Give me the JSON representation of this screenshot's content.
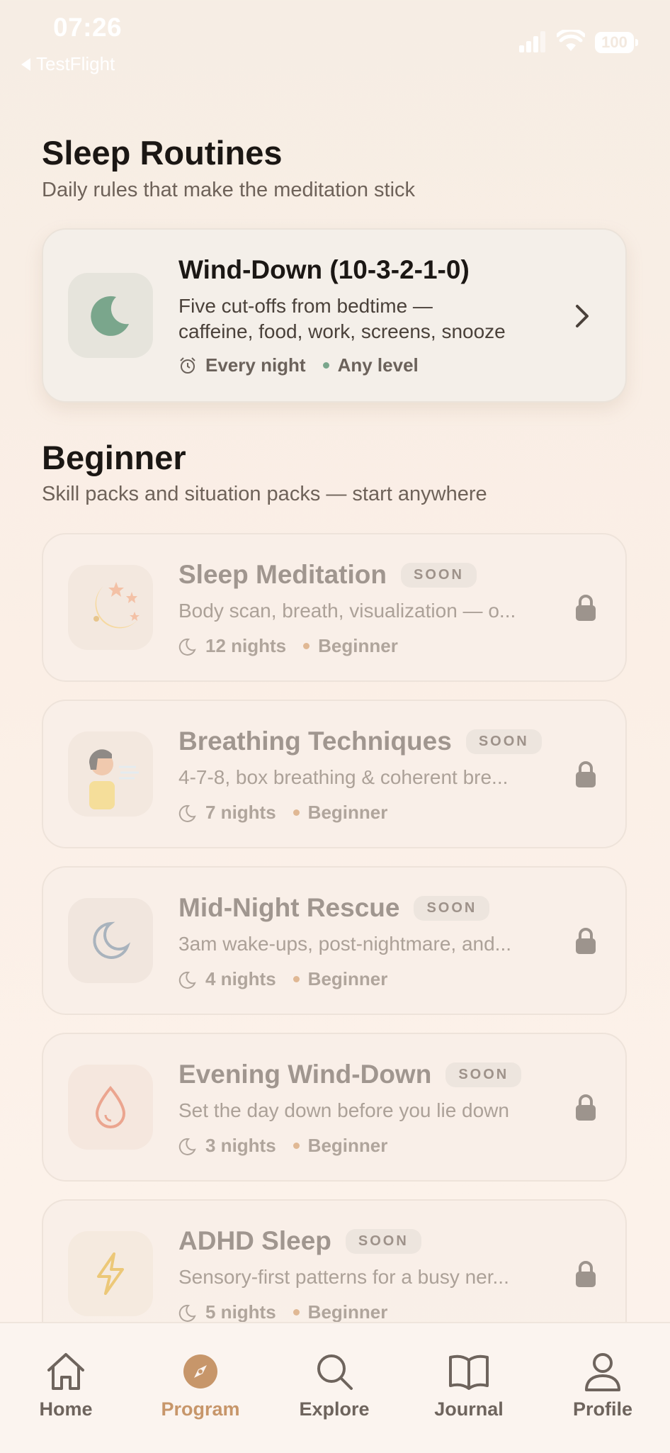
{
  "status_bar": {
    "time": "07:26",
    "back_label": "TestFlight",
    "battery": "100"
  },
  "routines": {
    "title": "Sleep Routines",
    "subtitle": "Daily rules that make the meditation stick",
    "card": {
      "title": "Wind-Down (10-3-2-1-0)",
      "desc_line1": "Five cut-offs from bedtime —",
      "desc_line2": "caffeine, food, work, screens, snooze",
      "meta1": "Every night",
      "meta2": "Any level",
      "icon": "moon-icon"
    }
  },
  "beginner": {
    "title": "Beginner",
    "subtitle": "Skill packs and situation packs — start anywhere",
    "badge_label": "SOON",
    "packs": [
      {
        "title": "Sleep Meditation",
        "desc": "Body scan, breath, visualization — o...",
        "nights": "12 nights",
        "level": "Beginner",
        "icon": "moon-stars-icon"
      },
      {
        "title": "Breathing Techniques",
        "desc": "4-7-8, box breathing & coherent bre...",
        "nights": "7 nights",
        "level": "Beginner",
        "icon": "person-breathing-icon"
      },
      {
        "title": "Mid-Night Rescue",
        "desc": "3am wake-ups, post-nightmare, and...",
        "nights": "4 nights",
        "level": "Beginner",
        "icon": "crescent-icon"
      },
      {
        "title": "Evening Wind-Down",
        "desc": "Set the day down before you lie down",
        "nights": "3 nights",
        "level": "Beginner",
        "icon": "drop-icon"
      },
      {
        "title": "ADHD Sleep",
        "desc": "Sensory-first patterns for a busy ner...",
        "nights": "5 nights",
        "level": "Beginner",
        "icon": "lightning-icon"
      }
    ]
  },
  "tabs": [
    {
      "label": "Home",
      "icon": "home-icon"
    },
    {
      "label": "Program",
      "icon": "compass-icon",
      "active": true
    },
    {
      "label": "Explore",
      "icon": "search-icon"
    },
    {
      "label": "Journal",
      "icon": "book-icon"
    },
    {
      "label": "Profile",
      "icon": "person-icon"
    }
  ],
  "colors": {
    "accent": "#c7966a",
    "green_dot": "#7aa68c",
    "beige_dot": "#e0b894"
  }
}
